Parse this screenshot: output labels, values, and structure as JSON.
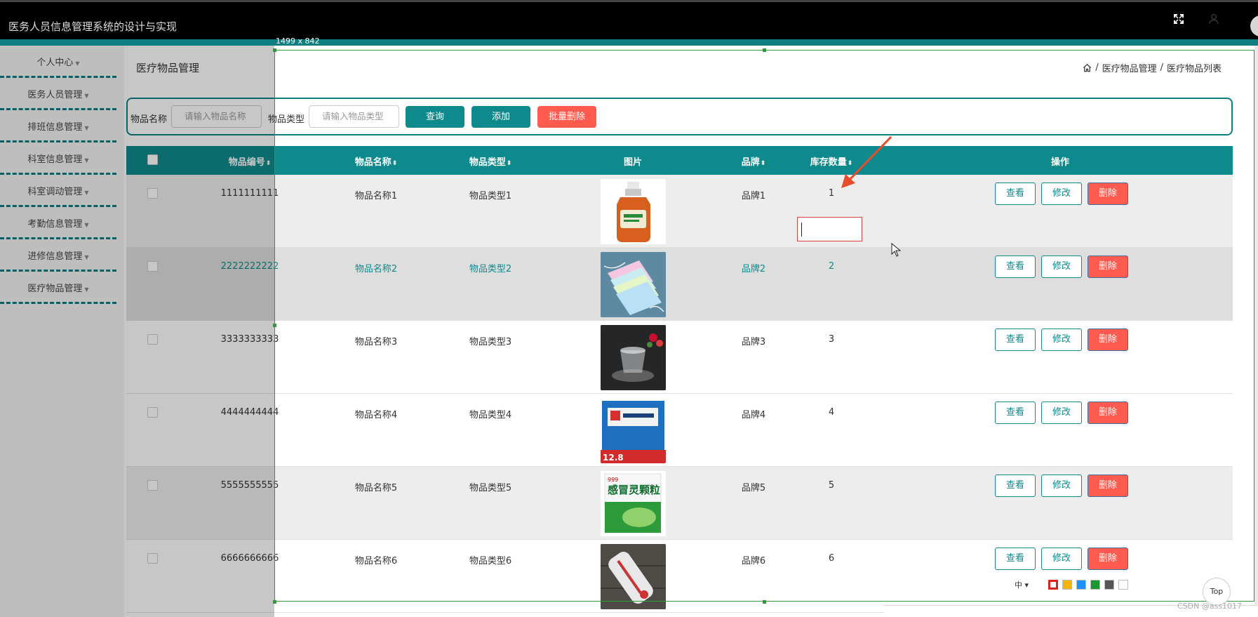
{
  "app": {
    "title": "医务人员信息管理系统的设计与实现"
  },
  "header_icons": {
    "fullscreen": "fullscreen-icon",
    "user": "user-icon"
  },
  "sidebar": {
    "items": [
      {
        "label": "个人中心"
      },
      {
        "label": "医务人员管理"
      },
      {
        "label": "排班信息管理"
      },
      {
        "label": "科室信息管理"
      },
      {
        "label": "科室调动管理"
      },
      {
        "label": "考勤信息管理"
      },
      {
        "label": "进修信息管理"
      },
      {
        "label": "医疗物品管理"
      }
    ]
  },
  "page": {
    "title": "医疗物品管理",
    "breadcrumb": [
      "医疗物品管理",
      "医疗物品列表"
    ],
    "breadcrumb_separator": "/"
  },
  "search": {
    "name_label": "物品名称",
    "name_placeholder": "请输入物品名称",
    "type_label": "物品类型",
    "type_placeholder": "请输入物品类型",
    "query_button": "查询",
    "add_button": "添加",
    "batch_delete_button": "批量删除"
  },
  "table": {
    "columns": [
      "物品编号",
      "物品名称",
      "物品类型",
      "图片",
      "品牌",
      "库存数量",
      "操作"
    ],
    "sort_glyph": "⬍",
    "rows": [
      {
        "id": "1111111111",
        "name": "物品名称1",
        "type": "物品类型1",
        "image": "disinfectant-bottle",
        "brand": "品牌1",
        "stock": "1"
      },
      {
        "id": "2222222222",
        "name": "物品名称2",
        "type": "物品类型2",
        "image": "face-masks",
        "brand": "品牌2",
        "stock": "2"
      },
      {
        "id": "3333333333",
        "name": "物品名称3",
        "type": "物品类型3",
        "image": "glass-cups",
        "brand": "品牌3",
        "stock": "3"
      },
      {
        "id": "4444444444",
        "name": "物品名称4",
        "type": "物品类型4",
        "image": "medicine-box",
        "brand": "品牌4",
        "stock": "4"
      },
      {
        "id": "5555555555",
        "name": "物品名称5",
        "type": "物品类型5",
        "image": "cold-granules-box",
        "brand": "品牌5",
        "stock": "5"
      },
      {
        "id": "6666666666",
        "name": "物品名称6",
        "type": "物品类型6",
        "image": "thermometer",
        "brand": "品牌6",
        "stock": "6"
      }
    ],
    "actions": {
      "view": "查看",
      "edit": "修改",
      "delete": "删除"
    }
  },
  "image_text": {
    "medicine_box_price": "12.8",
    "cold_box_brand": "999",
    "cold_box_title": "感冒灵颗粒"
  },
  "screenshot_tool": {
    "selection_size": "1499 x 842",
    "size_selector": "中 ▾",
    "colors": [
      "#e02020",
      "#f5b400",
      "#1e90ff",
      "#1a9a2e",
      "#555555",
      "#ffffff"
    ],
    "top_button": "Top",
    "watermark": "CSDN @ass1017"
  },
  "colors": {
    "primary": "#0f8a8c",
    "danger": "#ff5b4f",
    "header_bg": "#000000"
  }
}
